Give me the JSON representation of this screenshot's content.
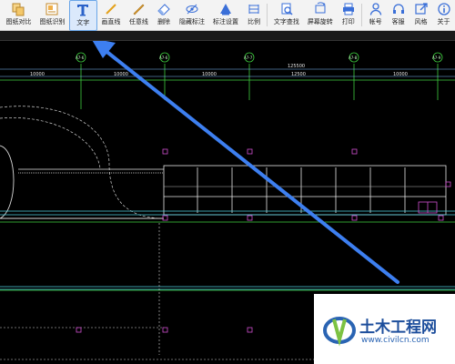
{
  "toolbar": {
    "tools": [
      {
        "label": "图纸对比",
        "icon": "compare-icon"
      },
      {
        "label": "图纸识别",
        "icon": "recognize-icon"
      },
      {
        "label": "文字",
        "icon": "text-tool-icon",
        "active": true
      },
      {
        "label": "画直线",
        "icon": "line-icon"
      },
      {
        "label": "任意线",
        "icon": "freeline-icon"
      },
      {
        "label": "删除",
        "icon": "eraser-icon"
      },
      {
        "label": "隐藏标注",
        "icon": "hide-annotation-icon"
      },
      {
        "label": "标注设置",
        "icon": "annotation-settings-icon"
      },
      {
        "label": "比例",
        "icon": "scale-icon"
      },
      {
        "label": "文字查找",
        "icon": "text-search-icon"
      },
      {
        "label": "屏幕旋转",
        "icon": "rotate-screen-icon"
      },
      {
        "label": "打印",
        "icon": "print-icon"
      },
      {
        "label": "帐号",
        "icon": "account-icon"
      },
      {
        "label": "客服",
        "icon": "headset-icon"
      },
      {
        "label": "风格",
        "icon": "style-icon"
      },
      {
        "label": "关于",
        "icon": "info-icon"
      }
    ]
  },
  "drawing": {
    "axes": [
      "A7-6",
      "A7-6",
      "A7-7",
      "A7-8",
      "A7-9"
    ],
    "dimensions": {
      "total": "125500",
      "segments": [
        "10000",
        "10000",
        "10000",
        "12500",
        "10000"
      ]
    }
  },
  "watermark": {
    "title": "土木工程网",
    "url": "www.civilcn.com"
  },
  "colors": {
    "toolbar_bg": "#f3f3f3",
    "canvas_bg": "#000000",
    "arrow": "#3d7ff0",
    "brand": "#1d4e9c"
  }
}
